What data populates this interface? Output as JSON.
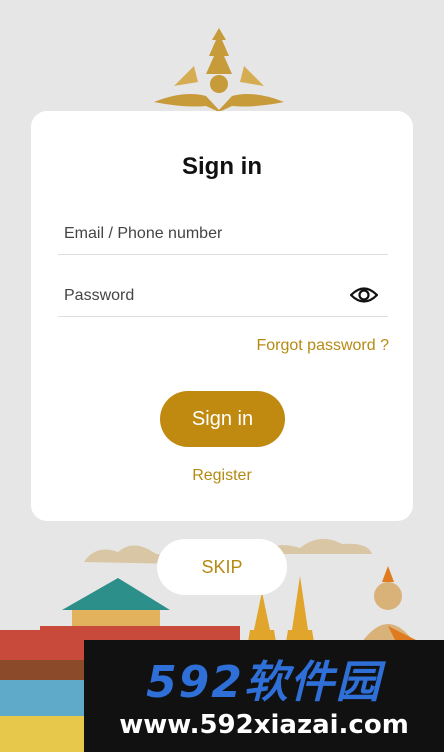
{
  "signin": {
    "title": "Sign in",
    "email_placeholder": "Email / Phone number",
    "password_placeholder": "Password",
    "forgot_password": "Forgot password ?",
    "signin_button": "Sign in",
    "register_link": "Register"
  },
  "skip_button": "SKIP",
  "watermark": {
    "logo_text": "592软件园",
    "url": "www.592xiazai.com"
  },
  "icons": {
    "emblem": "royal-emblem-icon",
    "password_toggle": "eye-icon"
  },
  "colors": {
    "background": "#e6e6e6",
    "accent": "#c08a10",
    "link": "#b58a14",
    "card": "#ffffff"
  }
}
